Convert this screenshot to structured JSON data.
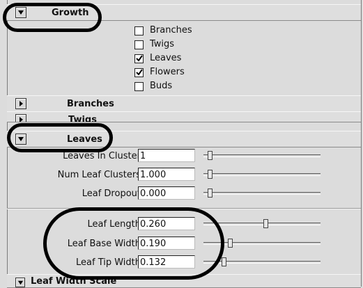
{
  "sections": {
    "growth": {
      "title": "Growth",
      "expanded": true
    },
    "branches": {
      "title": "Branches",
      "expanded": false
    },
    "twigs": {
      "title": "Twigs",
      "expanded": false
    },
    "leaves": {
      "title": "Leaves",
      "expanded": true
    },
    "leaf_width_scale": {
      "title": "Leaf Width Scale",
      "expanded": true
    }
  },
  "growth_options": [
    {
      "label": "Branches",
      "checked": false
    },
    {
      "label": "Twigs",
      "checked": false
    },
    {
      "label": "Leaves",
      "checked": true
    },
    {
      "label": "Flowers",
      "checked": true
    },
    {
      "label": "Buds",
      "checked": false
    }
  ],
  "leaf_attributes": [
    {
      "label": "Leaves In Cluster",
      "value": "1",
      "level": 0.0
    },
    {
      "label": "Num Leaf Clusters",
      "value": "1.000",
      "level": 0.0
    },
    {
      "label": "Leaf Dropout",
      "value": "0.000",
      "level": 0.0
    }
  ],
  "leaf_shape": [
    {
      "label": "Leaf Length",
      "value": "0.260",
      "level": 0.52
    },
    {
      "label": "Leaf Base Width",
      "value": "0.190",
      "level": 0.19
    },
    {
      "label": "Leaf Tip Width",
      "value": "0.132",
      "level": 0.13
    }
  ],
  "colors": {
    "panel": "#dcdcdc",
    "annotation_ring": "#000000"
  }
}
